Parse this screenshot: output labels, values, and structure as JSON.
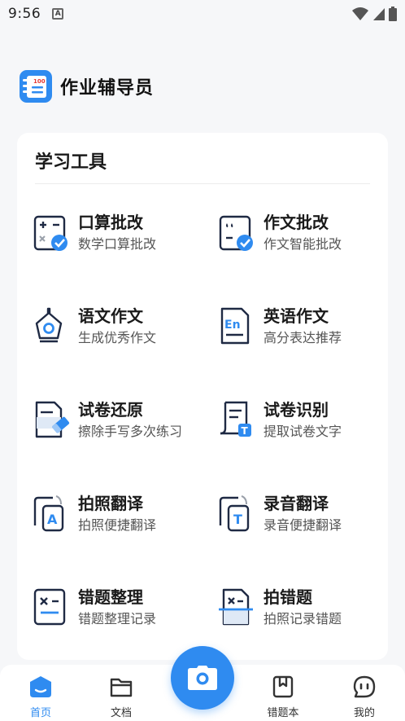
{
  "status_bar": {
    "time": "9:56",
    "badge_letter": "A"
  },
  "header": {
    "app_title": "作业辅导员",
    "logo_text": "100"
  },
  "tools_section": {
    "title": "学习工具",
    "items": [
      {
        "name": "口算批改",
        "desc": "数学口算批改",
        "icon": "oral-calc-icon"
      },
      {
        "name": "作文批改",
        "desc": "作文智能批改",
        "icon": "essay-correct-icon"
      },
      {
        "name": "语文作文",
        "desc": "生成优秀作文",
        "icon": "pen-nib-icon"
      },
      {
        "name": "英语作文",
        "desc": "高分表达推荐",
        "icon": "english-doc-icon"
      },
      {
        "name": "试卷还原",
        "desc": "擦除手写多次练习",
        "icon": "eraser-doc-icon"
      },
      {
        "name": "试卷识别",
        "desc": "提取试卷文字",
        "icon": "scan-text-icon"
      },
      {
        "name": "拍照翻译",
        "desc": "拍照便捷翻译",
        "icon": "photo-translate-icon"
      },
      {
        "name": "录音翻译",
        "desc": "录音便捷翻译",
        "icon": "audio-translate-icon"
      },
      {
        "name": "错题整理",
        "desc": "错题整理记录",
        "icon": "wrong-organize-icon"
      },
      {
        "name": "拍错题",
        "desc": "拍照记录错题",
        "icon": "photo-wrong-icon"
      }
    ]
  },
  "tab_bar": {
    "tabs": [
      {
        "label": "首页",
        "icon": "home-icon",
        "active": true
      },
      {
        "label": "文档",
        "icon": "folder-icon",
        "active": false
      },
      {
        "label": "错题本",
        "icon": "notebook-icon",
        "active": false
      },
      {
        "label": "我的",
        "icon": "profile-chat-icon",
        "active": false
      }
    ],
    "center_button_icon": "camera-icon"
  },
  "colors": {
    "accent": "#2f8bf0",
    "background": "#f6f7f9",
    "card": "#ffffff",
    "text_primary": "#1a1a1a",
    "text_secondary": "#555555"
  }
}
